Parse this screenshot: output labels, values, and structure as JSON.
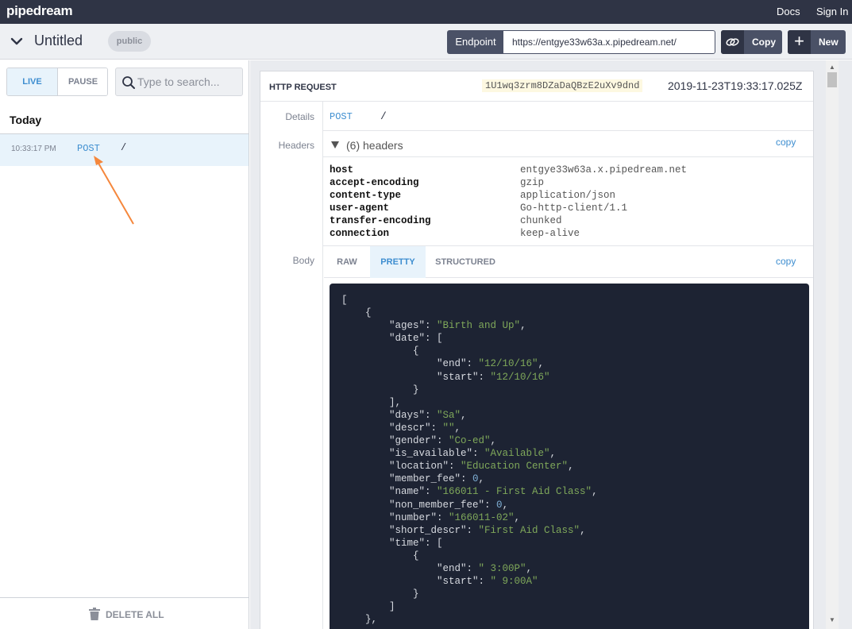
{
  "topbar": {
    "logo": "pipedream",
    "docs": "Docs",
    "signin": "Sign In"
  },
  "titlebar": {
    "title": "Untitled",
    "badge": "public",
    "endpoint_label": "Endpoint",
    "endpoint_url": "https://entgye33w63a.x.pipedream.net/",
    "copy_label": "Copy",
    "new_label": "New"
  },
  "left": {
    "live": "LIVE",
    "pause": "PAUSE",
    "search_placeholder": "Type to search...",
    "section": "Today",
    "events": [
      {
        "time": "10:33:17 PM",
        "method": "POST",
        "path": "/"
      }
    ],
    "delete_all": "DELETE ALL"
  },
  "request": {
    "header": "HTTP REQUEST",
    "id": "1U1wq3zrm8DZaDaQBzE2uXv9dnd",
    "timestamp": "2019-11-23T19:33:17.025Z",
    "details_label": "Details",
    "method": "POST",
    "path": "/",
    "headers_label": "Headers",
    "headers_toggle": "(6) headers",
    "copy": "copy",
    "headers": [
      {
        "key": "host",
        "value": "entgye33w63a.x.pipedream.net"
      },
      {
        "key": "accept-encoding",
        "value": "gzip"
      },
      {
        "key": "content-type",
        "value": "application/json"
      },
      {
        "key": "user-agent",
        "value": "Go-http-client/1.1"
      },
      {
        "key": "transfer-encoding",
        "value": "chunked"
      },
      {
        "key": "connection",
        "value": "keep-alive"
      }
    ],
    "body_label": "Body",
    "tabs": [
      "RAW",
      "PRETTY",
      "STRUCTURED"
    ],
    "active_tab": "PRETTY"
  },
  "body_lines": [
    [
      {
        "t": "p",
        "v": "["
      }
    ],
    [
      {
        "t": "p",
        "v": "    {"
      }
    ],
    [
      {
        "t": "p",
        "v": "        \"ages\": "
      },
      {
        "t": "s",
        "v": "\"Birth and Up\""
      },
      {
        "t": "p",
        "v": ","
      }
    ],
    [
      {
        "t": "p",
        "v": "        \"date\": ["
      }
    ],
    [
      {
        "t": "p",
        "v": "            {"
      }
    ],
    [
      {
        "t": "p",
        "v": "                \"end\": "
      },
      {
        "t": "s",
        "v": "\"12/10/16\""
      },
      {
        "t": "p",
        "v": ","
      }
    ],
    [
      {
        "t": "p",
        "v": "                \"start\": "
      },
      {
        "t": "s",
        "v": "\"12/10/16\""
      }
    ],
    [
      {
        "t": "p",
        "v": "            }"
      }
    ],
    [
      {
        "t": "p",
        "v": "        ],"
      }
    ],
    [
      {
        "t": "p",
        "v": "        \"days\": "
      },
      {
        "t": "s",
        "v": "\"Sa\""
      },
      {
        "t": "p",
        "v": ","
      }
    ],
    [
      {
        "t": "p",
        "v": "        \"descr\": "
      },
      {
        "t": "s",
        "v": "\"\""
      },
      {
        "t": "p",
        "v": ","
      }
    ],
    [
      {
        "t": "p",
        "v": "        \"gender\": "
      },
      {
        "t": "s",
        "v": "\"Co-ed\""
      },
      {
        "t": "p",
        "v": ","
      }
    ],
    [
      {
        "t": "p",
        "v": "        \"is_available\": "
      },
      {
        "t": "s",
        "v": "\"Available\""
      },
      {
        "t": "p",
        "v": ","
      }
    ],
    [
      {
        "t": "p",
        "v": "        \"location\": "
      },
      {
        "t": "s",
        "v": "\"Education Center\""
      },
      {
        "t": "p",
        "v": ","
      }
    ],
    [
      {
        "t": "p",
        "v": "        \"member_fee\": "
      },
      {
        "t": "n",
        "v": "0"
      },
      {
        "t": "p",
        "v": ","
      }
    ],
    [
      {
        "t": "p",
        "v": "        \"name\": "
      },
      {
        "t": "s",
        "v": "\"166011 - First Aid Class\""
      },
      {
        "t": "p",
        "v": ","
      }
    ],
    [
      {
        "t": "p",
        "v": "        \"non_member_fee\": "
      },
      {
        "t": "n",
        "v": "0"
      },
      {
        "t": "p",
        "v": ","
      }
    ],
    [
      {
        "t": "p",
        "v": "        \"number\": "
      },
      {
        "t": "s",
        "v": "\"166011-02\""
      },
      {
        "t": "p",
        "v": ","
      }
    ],
    [
      {
        "t": "p",
        "v": "        \"short_descr\": "
      },
      {
        "t": "s",
        "v": "\"First Aid Class\""
      },
      {
        "t": "p",
        "v": ","
      }
    ],
    [
      {
        "t": "p",
        "v": "        \"time\": ["
      }
    ],
    [
      {
        "t": "p",
        "v": "            {"
      }
    ],
    [
      {
        "t": "p",
        "v": "                \"end\": "
      },
      {
        "t": "s",
        "v": "\" 3:00P\""
      },
      {
        "t": "p",
        "v": ","
      }
    ],
    [
      {
        "t": "p",
        "v": "                \"start\": "
      },
      {
        "t": "s",
        "v": "\" 9:00A\""
      }
    ],
    [
      {
        "t": "p",
        "v": "            }"
      }
    ],
    [
      {
        "t": "p",
        "v": "        ]"
      }
    ],
    [
      {
        "t": "p",
        "v": "    },"
      }
    ]
  ],
  "colors": {
    "topbar": "#2f3445",
    "accent": "#3e8ed0",
    "string": "#7fa85a",
    "number": "#7fb0d6",
    "code_bg": "#1d2333",
    "arrow": "#f5873c"
  }
}
